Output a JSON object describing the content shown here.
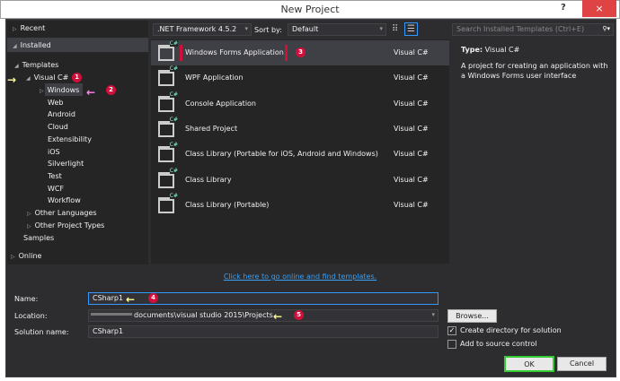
{
  "window": {
    "title": "New Project",
    "help": "?",
    "close": "×"
  },
  "tree": {
    "recent": "Recent",
    "installed": "Installed",
    "templates": "Templates",
    "visual_csharp": "Visual C#",
    "children": [
      "Windows",
      "Web",
      "Android",
      "Cloud",
      "Extensibility",
      "iOS",
      "Silverlight",
      "Test",
      "WCF",
      "Workflow"
    ],
    "other_languages": "Other Languages",
    "other_project_types": "Other Project Types",
    "samples": "Samples",
    "online": "Online"
  },
  "toolbar": {
    "framework": ".NET Framework 4.5.2",
    "sort_label": "Sort by:",
    "sort_value": "Default",
    "search_placeholder": "Search Installed Templates (Ctrl+E)"
  },
  "templates": [
    {
      "name": "Windows Forms Application",
      "lang": "Visual C#",
      "selected": true
    },
    {
      "name": "WPF Application",
      "lang": "Visual C#"
    },
    {
      "name": "Console Application",
      "lang": "Visual C#"
    },
    {
      "name": "Shared Project",
      "lang": "Visual C#"
    },
    {
      "name": "Class Library (Portable for iOS, Android and Windows)",
      "lang": "Visual C#"
    },
    {
      "name": "Class Library",
      "lang": "Visual C#"
    },
    {
      "name": "Class Library (Portable)",
      "lang": "Visual C#"
    }
  ],
  "details": {
    "type_label": "Type:",
    "type_value": "Visual C#",
    "description": "A project for creating an application with a Windows Forms user interface"
  },
  "online_link": "Click here to go online and find templates.",
  "form": {
    "name_label": "Name:",
    "name_value": "CSharp1",
    "location_label": "Location:",
    "location_value": "documents\\visual studio 2015\\Projects",
    "solution_label": "Solution name:",
    "solution_value": "CSharp1",
    "browse": "Browse...",
    "create_dir": "Create directory for solution",
    "create_dir_checked": true,
    "source_control": "Add to source control",
    "source_control_checked": false,
    "ok": "OK",
    "cancel": "Cancel"
  },
  "annotations": [
    "1",
    "2",
    "3",
    "4",
    "5"
  ],
  "colors": {
    "annotation": "#d0103a",
    "arrow_yellow": "#ffff99",
    "arrow_pink": "#ff88ee",
    "accent": "#3399ff",
    "ok_border": "#33cc33"
  }
}
